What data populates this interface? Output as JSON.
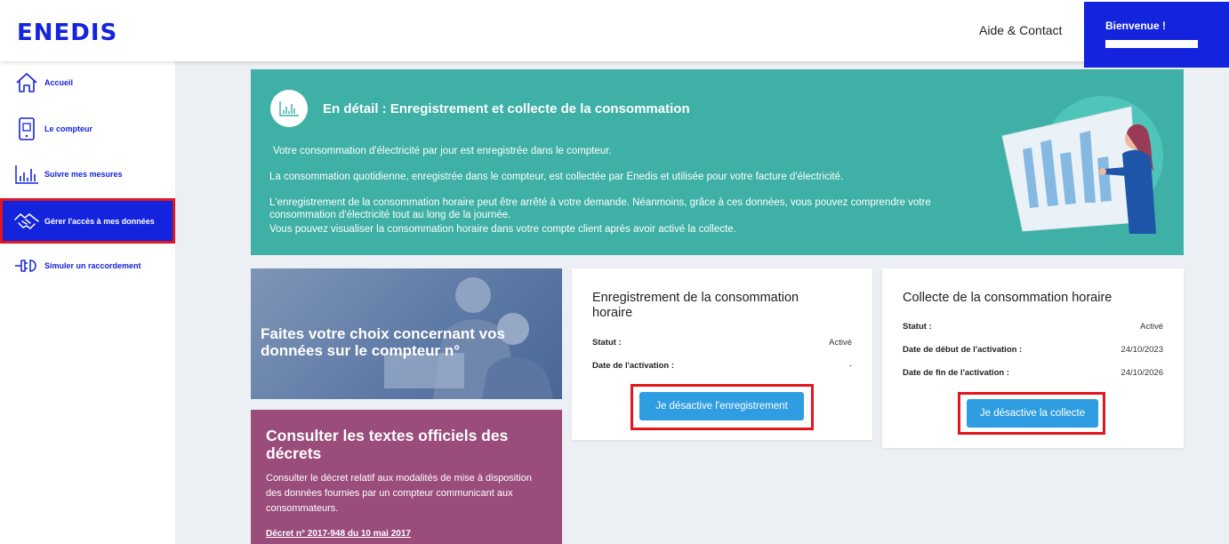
{
  "header": {
    "logo": "ENEDIS",
    "help_link": "Aide & Contact",
    "welcome": "Bienvenue !"
  },
  "sidebar": {
    "items": [
      {
        "label": "Accueil",
        "icon": "home-icon"
      },
      {
        "label": "Le compteur",
        "icon": "meter-icon"
      },
      {
        "label": "Suivre mes mesures",
        "icon": "chart-icon"
      },
      {
        "label": "Gérer l'accès à mes données",
        "icon": "handshake-icon",
        "active": true
      },
      {
        "label": "Simuler un raccordement",
        "icon": "plug-icon"
      }
    ]
  },
  "banner": {
    "title": "En détail : Enregistrement et collecte de la consommation",
    "p1": "Votre consommation d'électricité par jour est enregistrée dans le compteur.",
    "p2": "La consommation quotidienne, enregistrée dans le compteur, est collectée par Enedis et utilisée pour votre facture d'électricité.",
    "p3": "L'enregistrement de la consommation horaire peut être arrêté à votre demande. Néanmoins, grâce à ces données, vous pouvez comprendre votre consommation d'électricité tout au long de la journée.",
    "p4": "Vous pouvez visualiser la consommation horaire dans votre compte client après avoir activé la collecte.",
    "accent_color": "#3eb0a5"
  },
  "photo_card": {
    "title": "Faites votre choix concernant vos données sur le compteur n°"
  },
  "decret_card": {
    "title": "Consulter les textes officiels des décrets",
    "text": "Consulter le décret relatif aux modalités de mise à disposition des données fournies par un compteur communicant aux consommateurs.",
    "link": "Décret n° 2017-948 du 10 mai 2017",
    "color": "#9a4c7b"
  },
  "enregistrement": {
    "title": "Enregistrement de la consommation horaire",
    "status_label": "Statut :",
    "status_value": "Activé",
    "date_label": "Date de l'activation :",
    "date_value": "-",
    "button": "Je désactive l'enregistrement"
  },
  "collecte": {
    "title": "Collecte de la consommation horaire",
    "status_label": "Statut :",
    "status_value": "Activé",
    "start_label": "Date de début de l'activation :",
    "start_value": "24/10/2023",
    "end_label": "Date de fin de l'activation :",
    "end_value": "24/10/2026",
    "button": "Je désactive la collecte"
  },
  "colors": {
    "brand": "#1423dc",
    "button": "#2f9de2",
    "highlight": "#e4161d"
  }
}
